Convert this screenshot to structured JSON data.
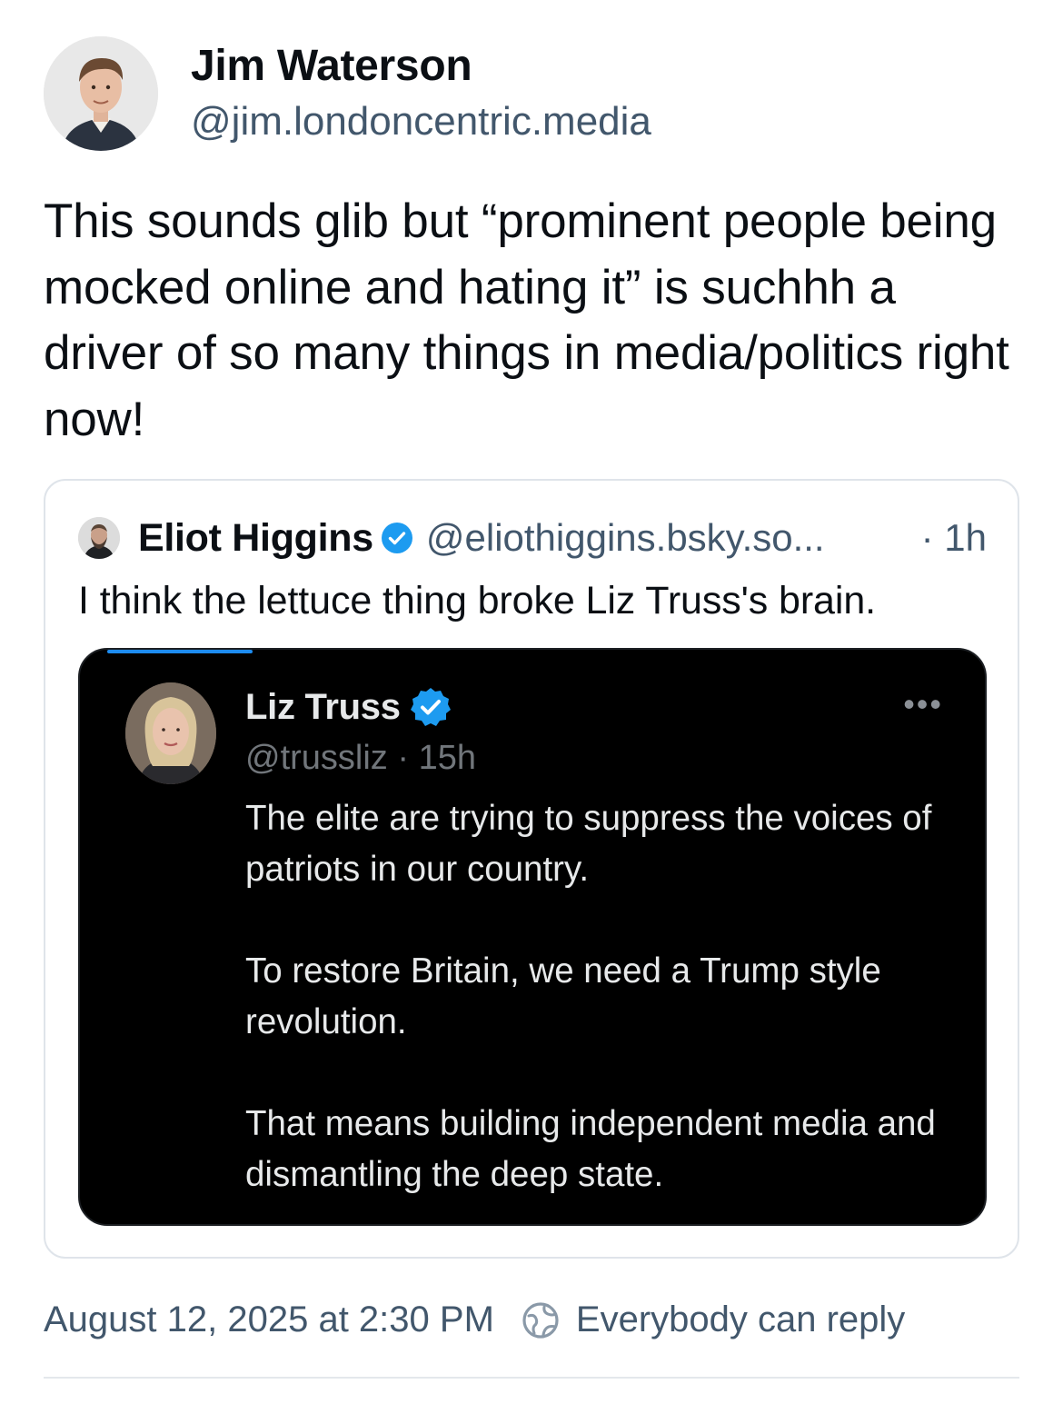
{
  "post": {
    "author_name": "Jim Waterson",
    "author_handle": "@jim.londoncentric.media",
    "text": "This sounds glib but “prominent people being mocked online and hating it” is suchhh a driver of so many things in media/politics right now!",
    "date": "August 12, 2025 at 2:30 PM",
    "reply_setting": "Everybody can reply"
  },
  "quote": {
    "author_name": "Eliot Higgins",
    "author_handle": "@eliothiggins.bsky.so...",
    "time": "· 1h",
    "text": "I think the lettuce thing broke Liz Truss's brain."
  },
  "embedded": {
    "author_name": "Liz Truss",
    "handle_time": "@trussliz · 15h",
    "more": "•••",
    "paragraphs": [
      "The elite are trying to suppress the voices of patriots in our country.",
      "To restore Britain, we need a Trump style revolution.",
      "That means building independent media and dismantling the deep state."
    ]
  },
  "colors": {
    "verified_blue": "#1d9bf0",
    "handle_gray": "#42576c"
  },
  "icons": {
    "verified": "verified-badge-icon",
    "reply_setting": "globe-icon",
    "more": "more-options-icon"
  }
}
